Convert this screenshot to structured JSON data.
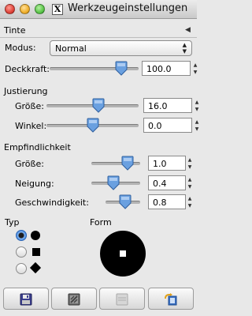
{
  "window": {
    "title": "Werkzeugeinstellungen"
  },
  "dock": {
    "title": "Tinte"
  },
  "mode": {
    "label": "Modus:",
    "value": "Normal"
  },
  "opacity": {
    "label": "Deckkraft:",
    "value": "100.0",
    "fraction": 0.86
  },
  "adjustment": {
    "heading": "Justierung",
    "size": {
      "label": "Größe:",
      "value": "16.0",
      "fraction": 0.57
    },
    "angle": {
      "label": "Winkel:",
      "value": "0.0",
      "fraction": 0.5
    }
  },
  "sensitivity": {
    "heading": "Empfindlichkeit",
    "size": {
      "label": "Größe:",
      "value": "1.0",
      "fraction": 0.82
    },
    "tilt": {
      "label": "Neigung:",
      "value": "0.4",
      "fraction": 0.43
    },
    "speed": {
      "label": "Geschwindigkeit:",
      "value": "0.8",
      "fraction": 0.6
    }
  },
  "type": {
    "label": "Typ",
    "options": [
      {
        "shape": "circle",
        "selected": true
      },
      {
        "shape": "square",
        "selected": false
      },
      {
        "shape": "diamond",
        "selected": false
      }
    ]
  },
  "form": {
    "label": "Form"
  },
  "buttons": [
    {
      "icon": "save-floppy-icon"
    },
    {
      "icon": "restore-icon"
    },
    {
      "icon": "delete-icon"
    },
    {
      "icon": "reset-icon"
    }
  ],
  "colors": {
    "thumb": "#6aa0e0",
    "selection": "#3a7fd6"
  }
}
